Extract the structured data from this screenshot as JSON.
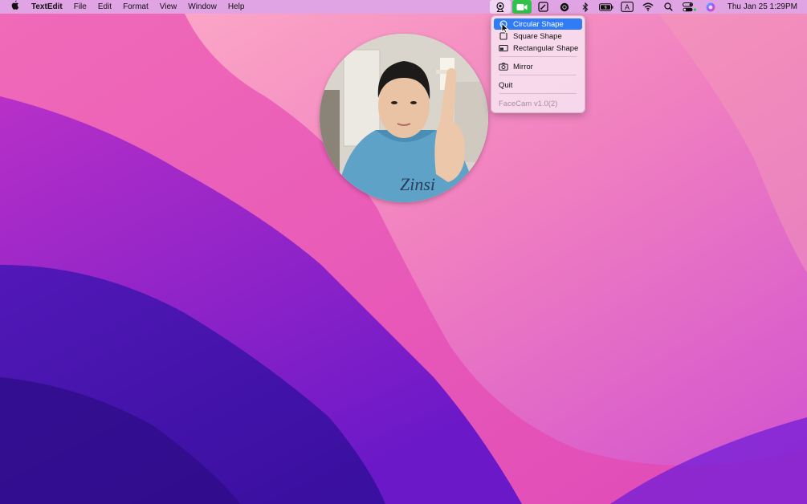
{
  "menubar": {
    "app_name": "TextEdit",
    "menus": [
      "File",
      "Edit",
      "Format",
      "View",
      "Window",
      "Help"
    ],
    "clock": "Thu Jan 25  1:29PM",
    "tray_icons": [
      "facecam-icon",
      "facetime-icon",
      "screen-note-icon",
      "record-icon",
      "bluetooth-icon",
      "battery-icon",
      "input-source-icon",
      "wifi-icon",
      "search-icon",
      "control-center-icon",
      "siri-icon"
    ],
    "input_source_label": "A"
  },
  "menu": {
    "items": [
      {
        "label": "Circular Shape",
        "icon": "circle-shape-icon",
        "selected": true
      },
      {
        "label": "Square Shape",
        "icon": "square-shape-icon"
      },
      {
        "label": "Rectangular Shape",
        "icon": "rectangle-shape-icon"
      },
      {
        "label": "Mirror",
        "icon": "camera-icon"
      },
      {
        "label": "Quit"
      },
      {
        "label": "FaceCam v1.0(2)",
        "disabled": true
      }
    ]
  },
  "colors": {
    "menu_selection": "#2f7cf6",
    "facetime_green": "#2ec24a"
  }
}
